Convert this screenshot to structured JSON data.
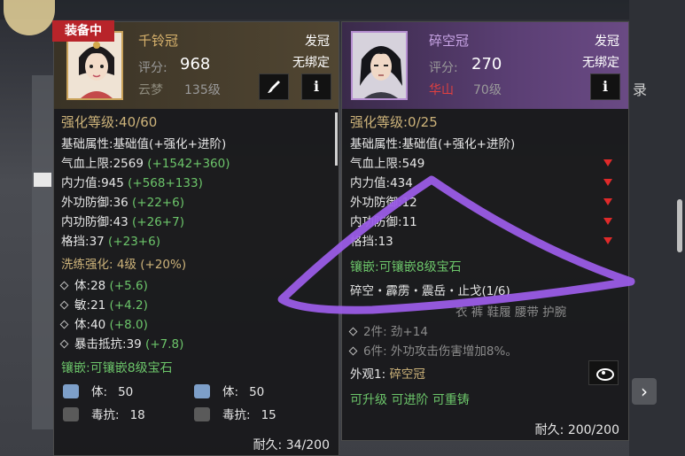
{
  "background": {
    "right_label": "录",
    "next_button": "›"
  },
  "left": {
    "equipped_tag": "装备中",
    "name": "千铃冠",
    "slot": "发冠",
    "bind": "无绑定",
    "score_label": "评分:",
    "score": "968",
    "school": "云梦",
    "level": "135级",
    "brush_icon": "paintbrush-icon",
    "info_icon": "info-icon",
    "enhance": "强化等级:40/60",
    "base_header": "基础属性:",
    "base_desc": "基础值(+强化+进阶)",
    "stats": [
      {
        "label": "气血上限:",
        "value": "2569",
        "bonus": "(+1542+360)"
      },
      {
        "label": "内力值:",
        "value": "945",
        "bonus": "(+568+133)"
      },
      {
        "label": "外功防御:",
        "value": "36",
        "bonus": "(+22+6)"
      },
      {
        "label": "内功防御:",
        "value": "43",
        "bonus": "(+26+7)"
      },
      {
        "label": "格挡:",
        "value": "37",
        "bonus": "(+23+6)"
      }
    ],
    "refine_title": "洗练强化:",
    "refine_level": "4级",
    "refine_bonus": "(+20%)",
    "refine": [
      {
        "label": "体:",
        "value": "28",
        "bonus": "(+5.6)"
      },
      {
        "label": "敏:",
        "value": "21",
        "bonus": "(+4.2)"
      },
      {
        "label": "体:",
        "value": "40",
        "bonus": "(+8.0)"
      },
      {
        "label": "暴击抵抗:",
        "value": "39",
        "bonus": "(+7.8)"
      }
    ],
    "socket_title": "镶嵌:可镶嵌8级宝石",
    "gems": [
      {
        "label": "体:",
        "value": "50"
      },
      {
        "label": "体:",
        "value": "50"
      },
      {
        "label": "毒抗:",
        "value": "18"
      },
      {
        "label": "毒抗:",
        "value": "15"
      }
    ],
    "durability_label": "耐久:",
    "durability": "34/200"
  },
  "right": {
    "name": "碎空冠",
    "slot": "发冠",
    "bind": "无绑定",
    "score_label": "评分:",
    "score": "270",
    "school": "华山",
    "level": "70级",
    "info_icon": "info-icon",
    "enhance": "强化等级:0/25",
    "base_header": "基础属性:",
    "base_desc": "基础值(+强化+进阶)",
    "stats": [
      {
        "label": "气血上限:",
        "value": "549"
      },
      {
        "label": "内力值:",
        "value": "434"
      },
      {
        "label": "外功防御:",
        "value": "12"
      },
      {
        "label": "内功防御:",
        "value": "11"
      },
      {
        "label": "格挡:",
        "value": "13"
      }
    ],
    "socket_title": "镶嵌:可镶嵌8级宝石",
    "set_name": "碎空・霹雳・震岳・止戈(1/6)",
    "set_parts": "衣 裤 鞋履 腰带 护腕",
    "set_effects": [
      "2件: 劲+14",
      "6件: 外功攻击伤害增加8%。"
    ],
    "appearance_label": "外观1:",
    "appearance": "碎空冠",
    "actions": "可升级 可进阶 可重铸",
    "durability_label": "耐久:",
    "durability": "200/200",
    "down_arrow_color": "#e02a2a",
    "eye_icon": "eye-icon"
  }
}
